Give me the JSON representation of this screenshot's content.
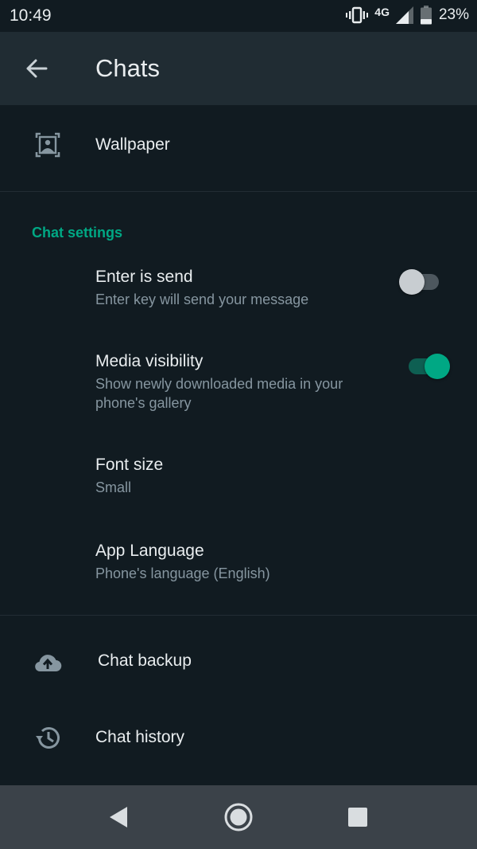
{
  "status_bar": {
    "time": "10:49",
    "network": "4G",
    "battery": "23%"
  },
  "header": {
    "title": "Chats"
  },
  "wallpaper": {
    "label": "Wallpaper"
  },
  "chat_settings": {
    "section_title": "Chat settings",
    "enter_is_send": {
      "title": "Enter is send",
      "subtitle": "Enter key will send your message",
      "enabled": false
    },
    "media_visibility": {
      "title": "Media visibility",
      "subtitle_line1": "Show newly downloaded media in your",
      "subtitle_line2": "phone's gallery",
      "enabled": true
    },
    "font_size": {
      "title": "Font size",
      "value": "Small"
    },
    "app_language": {
      "title": "App Language",
      "value": "Phone's language (English)"
    }
  },
  "chat_backup": {
    "label": "Chat backup"
  },
  "chat_history": {
    "label": "Chat history"
  },
  "colors": {
    "accent": "#00a884",
    "background": "#111b21",
    "appbar": "#202c33",
    "secondary_text": "#8696a0"
  },
  "icons": [
    "back-arrow-icon",
    "wallpaper-icon",
    "cloud-upload-icon",
    "history-icon",
    "vibrate-icon",
    "signal-icon",
    "battery-icon"
  ]
}
